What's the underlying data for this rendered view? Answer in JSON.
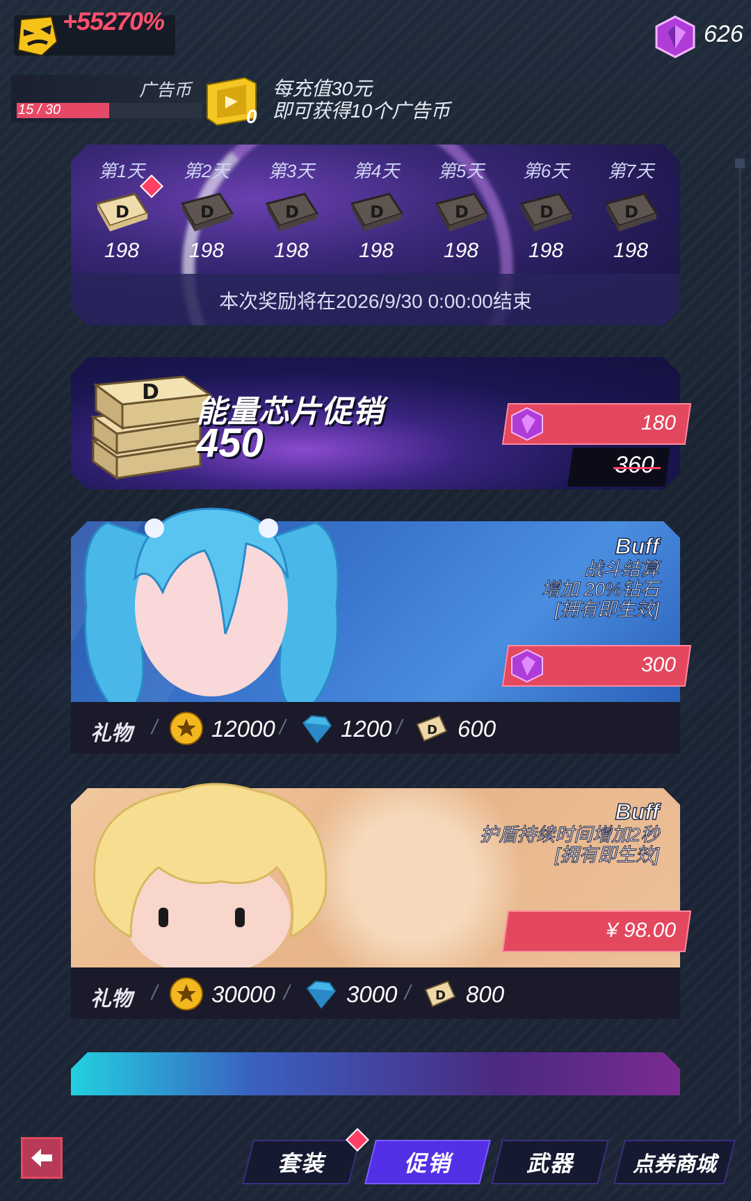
{
  "header": {
    "boost_text": "+55270%",
    "gem_count": "626"
  },
  "ad": {
    "label": "广告币",
    "progress_text": "15 / 30",
    "progress_ratio": 0.5,
    "coin_count": "0",
    "note_line1": "每充值30元",
    "note_line2": "即可获得10个广告币"
  },
  "signin": {
    "days": [
      {
        "label": "第1天",
        "value": "198"
      },
      {
        "label": "第2天",
        "value": "198"
      },
      {
        "label": "第3天",
        "value": "198"
      },
      {
        "label": "第4天",
        "value": "198"
      },
      {
        "label": "第5天",
        "value": "198"
      },
      {
        "label": "第6天",
        "value": "198"
      },
      {
        "label": "第7天",
        "value": "198"
      }
    ],
    "end_text": "本次奖励将在2026/9/30 0:00:00结束"
  },
  "chip_promo": {
    "title": "能量芯片促销",
    "count": "450",
    "price": "180",
    "original_price": "360"
  },
  "blue_hair": {
    "buff_title": "Buff",
    "buff_lines": [
      "战斗结算",
      "增加 20%钻石",
      "[拥有即生效]"
    ],
    "price": "300",
    "gift_label": "礼物",
    "gifts": [
      "12000",
      "1200",
      "600"
    ]
  },
  "blonde_hair": {
    "buff_title": "Buff",
    "buff_lines": [
      "护盾持续时间增加2秒",
      "[拥有即生效]"
    ],
    "price": "¥ 98.00",
    "gift_label": "礼物",
    "gifts": [
      "30000",
      "3000",
      "800"
    ]
  },
  "tabs": [
    "套装",
    "促销",
    "武器",
    "点券商城"
  ],
  "active_tab": "促销",
  "colors": {
    "accent_red": "#e3485f",
    "active_tab": "#5330e6",
    "boost_red": "#ff4f6d"
  }
}
